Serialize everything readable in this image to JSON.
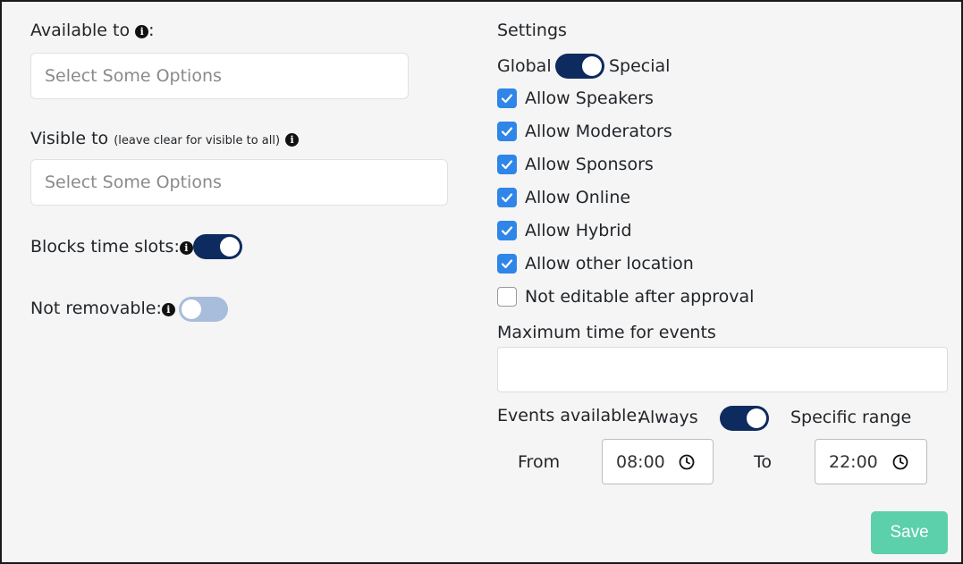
{
  "left": {
    "available_label": "Available to",
    "available_colon": ":",
    "available_placeholder": "Select Some Options",
    "visible_label": "Visible to",
    "visible_note": "(leave clear for visible to all)",
    "visible_placeholder": "Select Some Options",
    "blocks_label": "Blocks time slots:",
    "blocks_on": true,
    "not_removable_label": "Not removable:",
    "not_removable_on": false
  },
  "settings": {
    "title": "Settings",
    "global_label": "Global",
    "special_label": "Special",
    "checkboxes": [
      {
        "label": "Allow Speakers",
        "checked": true
      },
      {
        "label": "Allow Moderators",
        "checked": true
      },
      {
        "label": "Allow Sponsors",
        "checked": true
      },
      {
        "label": "Allow Online",
        "checked": true
      },
      {
        "label": "Allow Hybrid",
        "checked": true
      },
      {
        "label": "Allow other location",
        "checked": true
      },
      {
        "label": "Not editable after approval",
        "checked": false
      }
    ],
    "max_time_label": "Maximum time for events",
    "max_time_value": "",
    "events_available_label": "Events available:",
    "always_label": "Always",
    "specific_range_label": "Specific range",
    "from_label": "From",
    "from_value": "08:00",
    "to_label": "To",
    "to_value": "22:00"
  },
  "save_label": "Save",
  "colors": {
    "toggle_on": "#0d2b5e",
    "toggle_off": "#a8bcdb",
    "checkbox": "#2f86e8",
    "save_button": "#5ccfab"
  },
  "icons": [
    "info-icon",
    "check-icon",
    "clock-icon"
  ]
}
